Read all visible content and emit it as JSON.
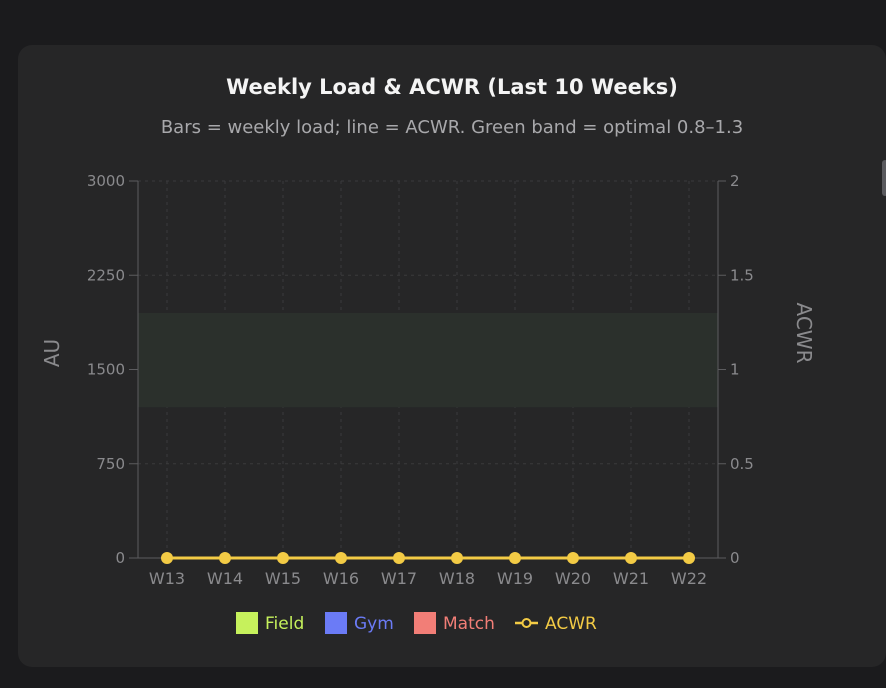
{
  "chart_data": {
    "type": "bar",
    "title": "Weekly Load & ACWR (Last 10 Weeks)",
    "subtitle": "Bars = weekly load; line = ACWR. Green band = optimal 0.8–1.3",
    "categories": [
      "W13",
      "W14",
      "W15",
      "W16",
      "W17",
      "W18",
      "W19",
      "W20",
      "W21",
      "W22"
    ],
    "series": [
      {
        "name": "Field",
        "kind": "bar",
        "axis": "left",
        "color": "#c6f15c",
        "values": [
          0,
          0,
          0,
          0,
          0,
          0,
          0,
          0,
          0,
          0
        ]
      },
      {
        "name": "Gym",
        "kind": "bar",
        "axis": "left",
        "color": "#6b7bf6",
        "values": [
          0,
          0,
          0,
          0,
          0,
          0,
          0,
          0,
          0,
          0
        ]
      },
      {
        "name": "Match",
        "kind": "bar",
        "axis": "left",
        "color": "#f27e77",
        "values": [
          0,
          0,
          0,
          0,
          0,
          0,
          0,
          0,
          0,
          0
        ]
      },
      {
        "name": "ACWR",
        "kind": "line",
        "axis": "right",
        "color": "#f3cb45",
        "values": [
          0,
          0,
          0,
          0,
          0,
          0,
          0,
          0,
          0,
          0
        ]
      }
    ],
    "ylabel": "AU",
    "ylabel_right": "ACWR",
    "ylim": [
      0,
      3000
    ],
    "yticks": [
      "0",
      "750",
      "1500",
      "2250",
      "3000"
    ],
    "ylim_right": [
      0,
      2
    ],
    "yticks_right": [
      "0",
      "0.5",
      "1",
      "1.5",
      "2"
    ],
    "optimal_band": [
      0.8,
      1.3
    ],
    "band_color": "#2b302c",
    "grid": true,
    "legend_position": "bottom"
  }
}
